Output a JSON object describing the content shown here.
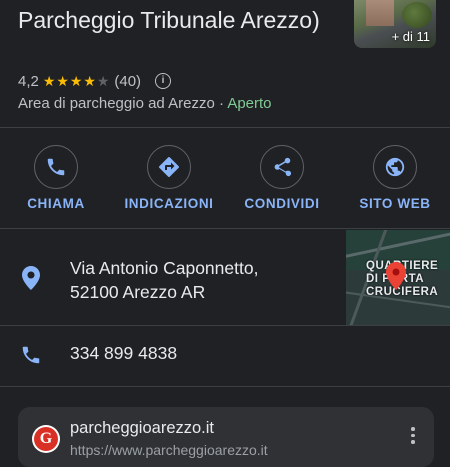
{
  "place": {
    "title": "Parcheggio Tribunale Arezzo)",
    "photo_count_label": "+ di 11",
    "rating": "4,2",
    "stars": 4.2,
    "reviews": "(40)",
    "category": "Area di parcheggio ad Arezzo",
    "separator": " · ",
    "status": "Aperto"
  },
  "actions": [
    {
      "label": "CHIAMA",
      "icon": "phone-icon"
    },
    {
      "label": "INDICAZIONI",
      "icon": "directions-icon"
    },
    {
      "label": "CONDIVIDI",
      "icon": "share-icon"
    },
    {
      "label": "SITO WEB",
      "icon": "globe-icon"
    }
  ],
  "address": {
    "line1": "Via Antonio Caponnetto,",
    "line2": "52100 Arezzo AR",
    "map_label_1": "QUARTIERE",
    "map_label_2": "DI PORTA",
    "map_label_3": "CRUCIFERA"
  },
  "phone": {
    "number": "334 899 4838"
  },
  "website_card": {
    "site": "parcheggioarezzo.it",
    "url": "https://www.parcheggioarezzo.it",
    "icon_letter": "G"
  },
  "colors": {
    "background": "#202124",
    "accent": "#8ab4f8",
    "open": "#81c995",
    "star": "#fbbc04"
  }
}
